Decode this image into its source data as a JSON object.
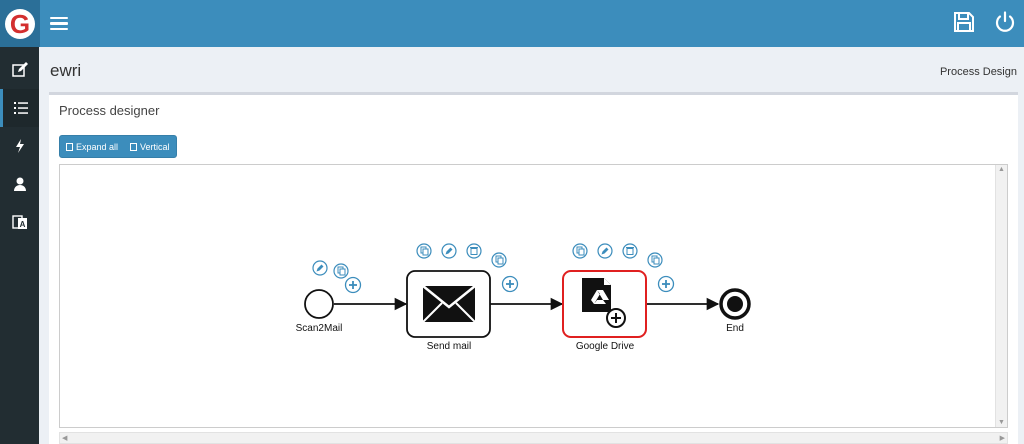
{
  "app": {
    "logo_letter": "G"
  },
  "header": {
    "save_icon": "save-icon",
    "power_icon": "power-icon"
  },
  "sidebar": {
    "items": [
      "edit-icon",
      "list-icon",
      "bolt-icon",
      "user-icon",
      "translate-icon"
    ]
  },
  "page": {
    "title": "ewri",
    "breadcrumb": "Process Design"
  },
  "designer": {
    "title": "Process designer",
    "buttons": {
      "expand_all": "Expand all",
      "vertical": "Vertical"
    },
    "nodes": {
      "start": "Scan2Mail",
      "task1": "Send mail",
      "task2": "Google Drive",
      "end": "End"
    },
    "colors": {
      "accent": "#3c8dbc",
      "selected": "#e02020",
      "node_icons": "#3c8dbc"
    }
  }
}
